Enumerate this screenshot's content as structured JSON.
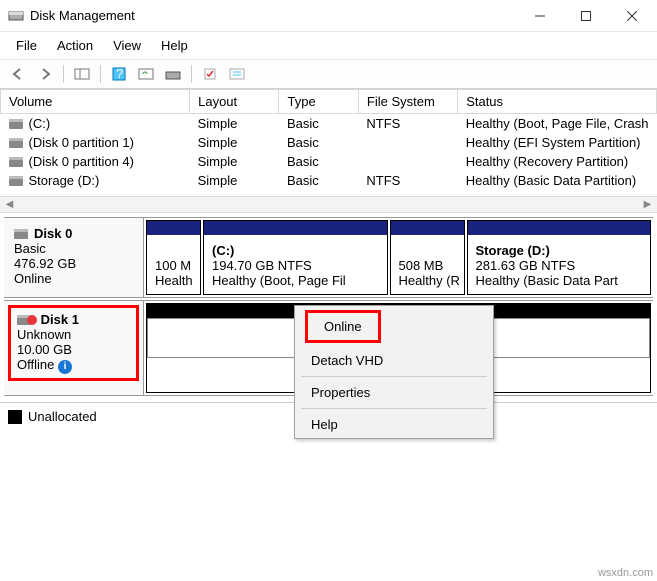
{
  "window": {
    "title": "Disk Management"
  },
  "menus": {
    "file": "File",
    "action": "Action",
    "view": "View",
    "help": "Help"
  },
  "columns": {
    "volume": "Volume",
    "layout": "Layout",
    "type": "Type",
    "fs": "File System",
    "status": "Status"
  },
  "volumes": [
    {
      "name": "(C:)",
      "layout": "Simple",
      "type": "Basic",
      "fs": "NTFS",
      "status": "Healthy (Boot, Page File, Crash"
    },
    {
      "name": "(Disk 0 partition 1)",
      "layout": "Simple",
      "type": "Basic",
      "fs": "",
      "status": "Healthy (EFI System Partition)"
    },
    {
      "name": "(Disk 0 partition 4)",
      "layout": "Simple",
      "type": "Basic",
      "fs": "",
      "status": "Healthy (Recovery Partition)"
    },
    {
      "name": "Storage (D:)",
      "layout": "Simple",
      "type": "Basic",
      "fs": "NTFS",
      "status": "Healthy (Basic Data Partition)"
    }
  ],
  "disk0": {
    "name": "Disk 0",
    "type": "Basic",
    "size": "476.92 GB",
    "state": "Online",
    "parts": [
      {
        "title": "",
        "line1": "100 M",
        "line2": "Health"
      },
      {
        "title": "(C:)",
        "line1": "194.70 GB NTFS",
        "line2": "Healthy (Boot, Page Fil"
      },
      {
        "title": "",
        "line1": "508 MB",
        "line2": "Healthy (R"
      },
      {
        "title": "Storage  (D:)",
        "line1": "281.63 GB NTFS",
        "line2": "Healthy (Basic Data Part"
      }
    ]
  },
  "disk1": {
    "name": "Disk 1",
    "type": "Unknown",
    "size": "10.00 GB",
    "state": "Offline"
  },
  "context_menu": {
    "online": "Online",
    "detach": "Detach VHD",
    "properties": "Properties",
    "help": "Help"
  },
  "legend": {
    "unallocated": "Unallocated"
  },
  "watermark": "wsxdn.com"
}
